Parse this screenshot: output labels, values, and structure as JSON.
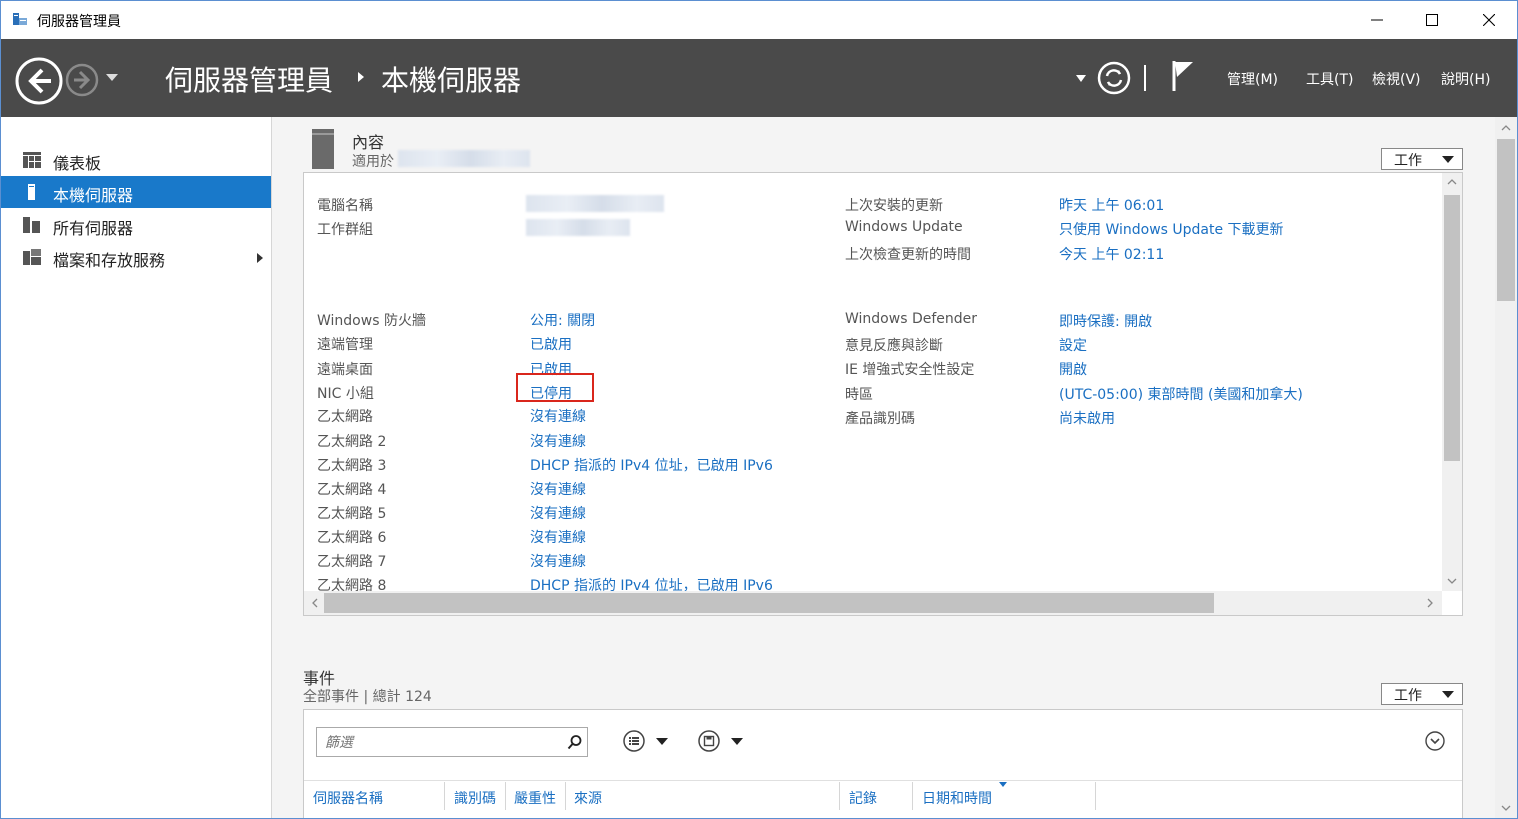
{
  "window": {
    "title": "伺服器管理員"
  },
  "nav": {
    "breadcrumb_root": "伺服器管理員",
    "breadcrumb_current": "本機伺服器",
    "menus": [
      "管理(M)",
      "工具(T)",
      "檢視(V)",
      "說明(H)"
    ]
  },
  "sidebar": {
    "items": [
      {
        "label": "儀表板",
        "icon": "dashboard-icon"
      },
      {
        "label": "本機伺服器",
        "icon": "server-icon",
        "active": true
      },
      {
        "label": "所有伺服器",
        "icon": "servers-icon"
      },
      {
        "label": "檔案和存放服務",
        "icon": "file-storage-icon",
        "has_children": true
      }
    ]
  },
  "properties": {
    "title": "內容",
    "subtitle": "適用於",
    "tasks_label": "工作",
    "left_top": [
      {
        "label": "電腦名稱",
        "value": ""
      },
      {
        "label": "工作群組",
        "value": ""
      }
    ],
    "right_top": [
      {
        "label": "上次安裝的更新",
        "value": "昨天 上午 06:01"
      },
      {
        "label": "Windows Update",
        "value": "只使用 Windows Update 下載更新"
      },
      {
        "label": "上次檢查更新的時間",
        "value": "今天 上午 02:11"
      }
    ],
    "left_bottom": [
      {
        "label": "Windows 防火牆",
        "value": "公用: 關閉"
      },
      {
        "label": "遠端管理",
        "value": "已啟用"
      },
      {
        "label": "遠端桌面",
        "value": "已啟用"
      },
      {
        "label": "NIC 小組",
        "value": "已停用"
      },
      {
        "label": "乙太網路",
        "value": "沒有連線"
      },
      {
        "label": "乙太網路 2",
        "value": "沒有連線"
      },
      {
        "label": "乙太網路 3",
        "value": "DHCP 指派的 IPv4 位址，已啟用 IPv6"
      },
      {
        "label": "乙太網路 4",
        "value": "沒有連線"
      },
      {
        "label": "乙太網路 5",
        "value": "沒有連線"
      },
      {
        "label": "乙太網路 6",
        "value": "沒有連線"
      },
      {
        "label": "乙太網路 7",
        "value": "沒有連線"
      },
      {
        "label": "乙太網路 8",
        "value": "DHCP 指派的 IPv4 位址，已啟用 IPv6"
      }
    ],
    "right_bottom": [
      {
        "label": "Windows Defender",
        "value": "即時保護: 開啟"
      },
      {
        "label": "意見反應與診斷",
        "value": "設定"
      },
      {
        "label": "IE 增強式安全性設定",
        "value": "開啟"
      },
      {
        "label": "時區",
        "value": "(UTC-05:00) 東部時間 (美國和加拿大)"
      },
      {
        "label": "產品識別碼",
        "value": "尚未啟用"
      }
    ]
  },
  "events": {
    "title": "事件",
    "subtitle": "全部事件 | 總計 124",
    "tasks_label": "工作",
    "filter_placeholder": "篩選",
    "columns": [
      "伺服器名稱",
      "識別碼",
      "嚴重性",
      "來源",
      "記錄",
      "日期和時間"
    ]
  },
  "colors": {
    "accent": "#1979ca",
    "link": "#1a6fc2",
    "header_bg": "#4a4a4a",
    "highlight": "#d9261c"
  }
}
